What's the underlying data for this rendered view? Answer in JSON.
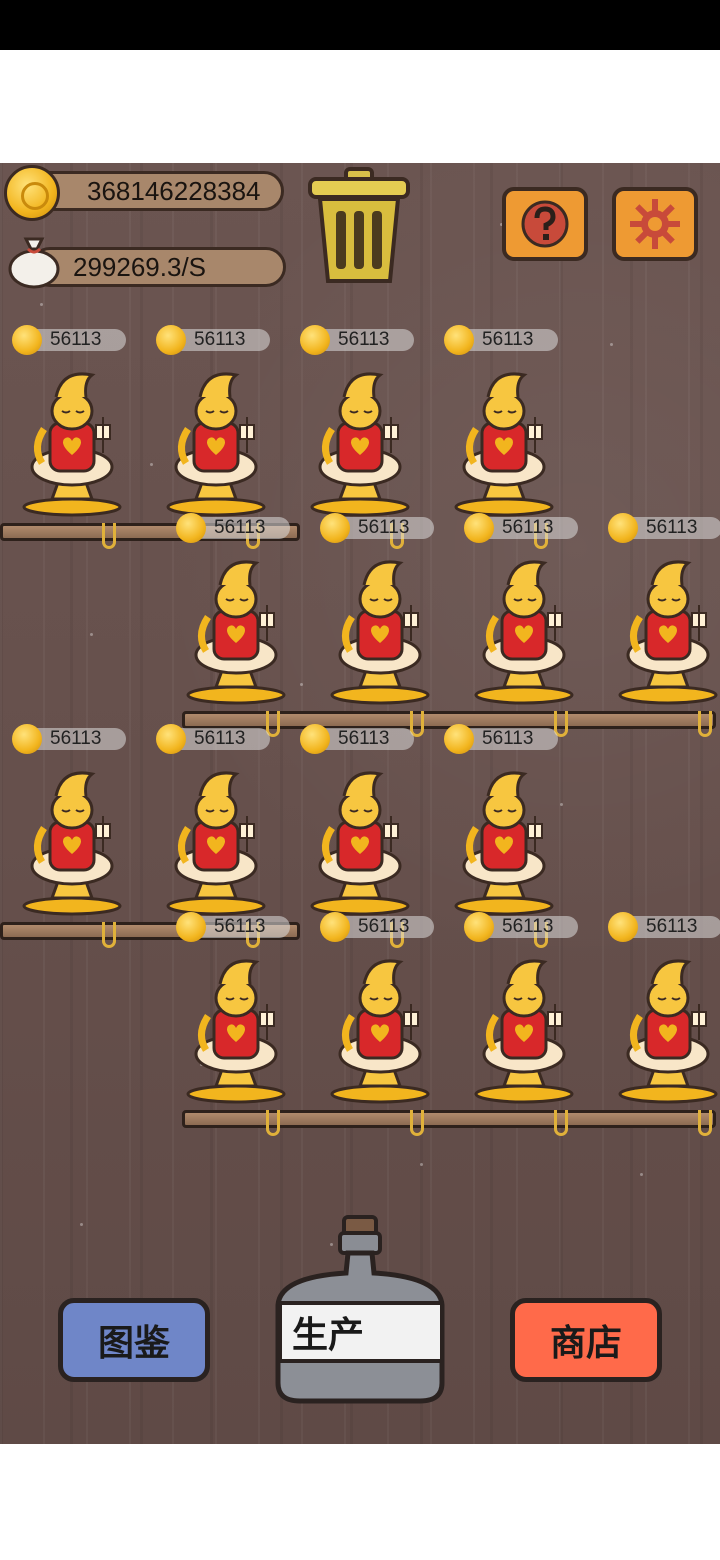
{
  "hud": {
    "coins": "368146228384",
    "income": "299269.3/S"
  },
  "buttons": {
    "collection": "图鉴",
    "produce": "生产",
    "shop": "商店"
  },
  "cats": [
    {
      "earn": "56113"
    },
    {
      "earn": "56113"
    },
    {
      "earn": "56113"
    },
    {
      "earn": "56113"
    },
    {
      "earn": "56113"
    },
    {
      "earn": "56113"
    },
    {
      "earn": "56113"
    },
    {
      "earn": "56113"
    },
    {
      "earn": "56113"
    },
    {
      "earn": "56113"
    },
    {
      "earn": "56113"
    },
    {
      "earn": "56113"
    },
    {
      "earn": "56113"
    },
    {
      "earn": "56113"
    },
    {
      "earn": "56113"
    },
    {
      "earn": "56113"
    }
  ],
  "colors": {
    "collection_button": "#6f86c8",
    "produce_label_bg": "#f2f2f2",
    "shop_button": "#ff6a4a",
    "help_button": "#ee9a33",
    "coin": "#f2b51e"
  },
  "icons": [
    "coin-icon",
    "money-bag-icon",
    "trash-can-icon",
    "help-icon",
    "settings-gear-icon",
    "bottle-icon"
  ]
}
